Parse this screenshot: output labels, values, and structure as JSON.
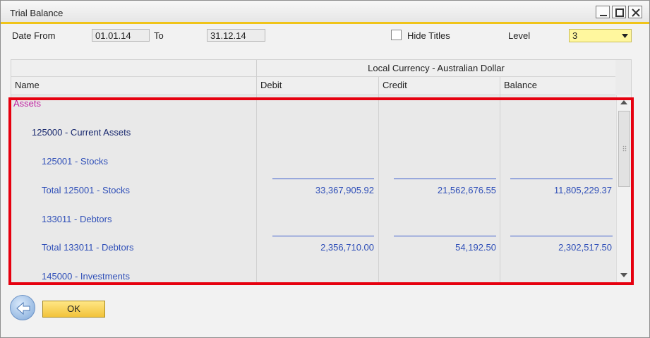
{
  "window": {
    "title": "Trial Balance"
  },
  "filters": {
    "date_from_label": "Date From",
    "date_from_value": "01.01.14",
    "to_label": "To",
    "to_value": "31.12.14",
    "hide_titles_label": "Hide Titles",
    "hide_titles_checked": false,
    "level_label": "Level",
    "level_value": "3"
  },
  "grid": {
    "group_header": "Local Currency - Australian Dollar",
    "columns": [
      "Name",
      "Debit",
      "Credit",
      "Balance"
    ],
    "rows": [
      {
        "name": "Assets",
        "debit": "",
        "credit": "",
        "balance": ""
      },
      {
        "name": "125000 - Current Assets",
        "debit": "",
        "credit": "",
        "balance": ""
      },
      {
        "name": "125001 - Stocks",
        "debit": "",
        "credit": "",
        "balance": ""
      },
      {
        "name": "Total 125001 - Stocks",
        "debit": "33,367,905.92",
        "credit": "21,562,676.55",
        "balance": "11,805,229.37"
      },
      {
        "name": "133011 - Debtors",
        "debit": "",
        "credit": "",
        "balance": ""
      },
      {
        "name": "Total 133011 - Debtors",
        "debit": "2,356,710.00",
        "credit": "54,192.50",
        "balance": "2,302,517.50"
      },
      {
        "name": "145000 - Investments",
        "debit": "",
        "credit": "",
        "balance": ""
      }
    ]
  },
  "buttons": {
    "ok_label": "OK"
  },
  "colors": {
    "accent": "#f0c419",
    "highlight": "#e6000f",
    "assets_text": "#c020a0",
    "account_text": "#2f4fb8",
    "level_field_bg": "#fff79e"
  }
}
